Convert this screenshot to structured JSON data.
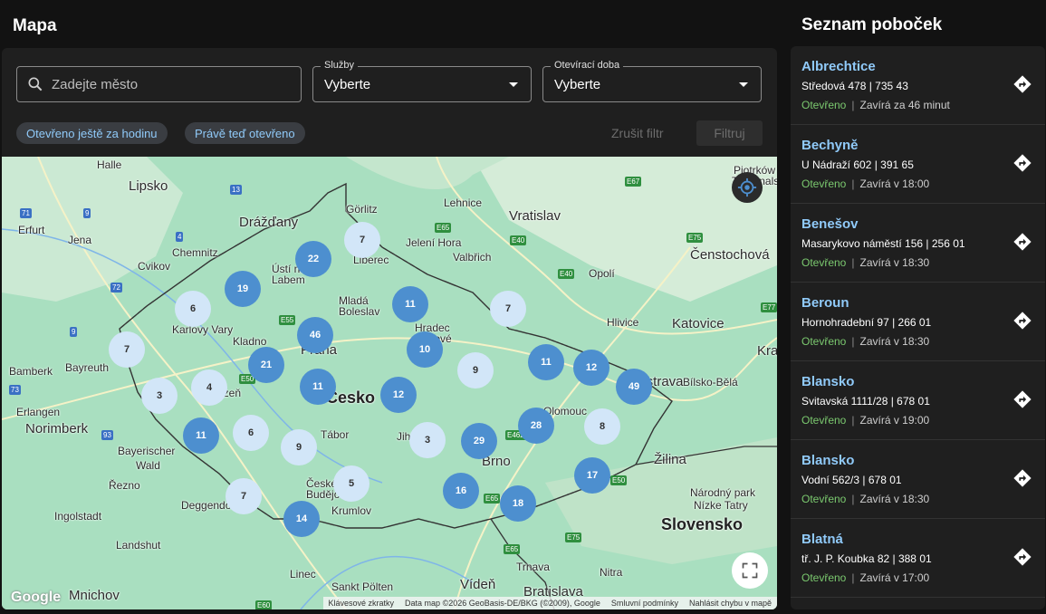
{
  "header": {
    "title": "Mapa"
  },
  "filters": {
    "search_placeholder": "Zadejte město",
    "services": {
      "label": "Služby",
      "value": "Vyberte"
    },
    "hours": {
      "label": "Otevírací doba",
      "value": "Vyberte"
    },
    "chips": [
      "Otevřeno ještě za hodinu",
      "Právě teď otevřeno"
    ],
    "clear_label": "Zrušit filtr",
    "filter_label": "Filtruj"
  },
  "map": {
    "places": {
      "halle": "Halle",
      "lipsko": "Lipsko",
      "erfurt": "Erfurt",
      "jena": "Jena",
      "drazdany": "Drážďany",
      "gorlitz": "Görlitz",
      "lehnice": "Lehnice",
      "vratislav": "Vratislav",
      "chemnitz": "Chemnitz",
      "cvikov": "Cvikov",
      "usti1": "Ústí nad",
      "usti2": "Labem",
      "liberec": "Liberec",
      "jelenigora": "Jelení Hora",
      "valbrich": "Valbřich",
      "opoli": "Opolí",
      "censtochova": "Čenstochová",
      "mlada1": "Mladá",
      "mlada2": "Boleslav",
      "hradec1": "Hradec",
      "hradec2": "Králové",
      "karlovy": "Karlovy Vary",
      "kladno": "Kladno",
      "praha": "Praha",
      "hlivice": "Hlivice",
      "katovice": "Katovice",
      "krakow": "Kra",
      "bamberk": "Bamberk",
      "bayreuth": "Bayreuth",
      "plzen": "Plzeň",
      "cesko": "Česko",
      "bielsko": "Bílsko-Bělá",
      "ostrava": "Ostrava",
      "erlangen": "Erlangen",
      "norimberk": "Norimberk",
      "olomouc": "Olomouc",
      "tabor": "Tábor",
      "jihlava": "Jihlava",
      "bayer1": "Bayerischer",
      "bayer2": "Wald",
      "brno": "Brno",
      "zilina": "Žilina",
      "rezno": "Řezno",
      "ceske1": "České",
      "ceske2": "Budějovice",
      "krumlov": "Krumlov",
      "deggendorf": "Deggendorf",
      "tatry1": "Národný park",
      "tatry2": "Nízke Tatry",
      "slovensko": "Slovensko",
      "ingolstadt": "Ingolstadt",
      "landshut": "Landshut",
      "trnava": "Trnava",
      "nitra": "Nitra",
      "linec": "Linec",
      "sanktpolten": "Sankt Pölten",
      "viden": "Vídeň",
      "bratislava": "Bratislava",
      "mnichov": "Mnichov",
      "piotrkow1": "Piotrków",
      "piotrkow2": "Trybunalski"
    },
    "roads": [
      "71",
      "9",
      "4",
      "72",
      "9",
      "73",
      "93",
      "E55",
      "E50",
      "E65",
      "E40",
      "E40",
      "E67",
      "E75",
      "E77",
      "E462",
      "E50",
      "E65",
      "E65",
      "E75",
      "E60",
      "13"
    ],
    "clusters": [
      {
        "count": "7",
        "kind": "light"
      },
      {
        "count": "22",
        "kind": "dark"
      },
      {
        "count": "19",
        "kind": "dark"
      },
      {
        "count": "6",
        "kind": "light"
      },
      {
        "count": "11",
        "kind": "dark"
      },
      {
        "count": "7",
        "kind": "light"
      },
      {
        "count": "46",
        "kind": "dark"
      },
      {
        "count": "7",
        "kind": "light"
      },
      {
        "count": "10",
        "kind": "dark"
      },
      {
        "count": "21",
        "kind": "dark"
      },
      {
        "count": "9",
        "kind": "light"
      },
      {
        "count": "11",
        "kind": "dark"
      },
      {
        "count": "12",
        "kind": "dark"
      },
      {
        "count": "4",
        "kind": "light"
      },
      {
        "count": "11",
        "kind": "dark"
      },
      {
        "count": "3",
        "kind": "light"
      },
      {
        "count": "12",
        "kind": "dark"
      },
      {
        "count": "49",
        "kind": "dark"
      },
      {
        "count": "28",
        "kind": "dark"
      },
      {
        "count": "8",
        "kind": "light"
      },
      {
        "count": "11",
        "kind": "dark"
      },
      {
        "count": "6",
        "kind": "light"
      },
      {
        "count": "9",
        "kind": "light"
      },
      {
        "count": "3",
        "kind": "light"
      },
      {
        "count": "29",
        "kind": "dark"
      },
      {
        "count": "17",
        "kind": "dark"
      },
      {
        "count": "5",
        "kind": "light"
      },
      {
        "count": "16",
        "kind": "dark"
      },
      {
        "count": "7",
        "kind": "light"
      },
      {
        "count": "18",
        "kind": "dark"
      },
      {
        "count": "14",
        "kind": "dark"
      }
    ],
    "google_logo": "Google",
    "attribution": [
      "Klávesové zkratky",
      "Data map ©2026 GeoBasis-DE/BKG (©2009), Google",
      "Smluvní podmínky",
      "Nahlásit chybu v mapě"
    ]
  },
  "list": {
    "title": "Seznam poboček",
    "branches": [
      {
        "name": "Albrechtice",
        "address": "Středová 478 | 735 43",
        "status": "Otevřeno",
        "closing": "Zavírá za 46 minut"
      },
      {
        "name": "Bechyně",
        "address": "U Nádraží 602 | 391 65",
        "status": "Otevřeno",
        "closing": "Zavírá v 18:00"
      },
      {
        "name": "Benešov",
        "address": "Masarykovo náměstí 156 | 256 01",
        "status": "Otevřeno",
        "closing": "Zavírá v 18:30"
      },
      {
        "name": "Beroun",
        "address": "Hornohradební 97 | 266 01",
        "status": "Otevřeno",
        "closing": "Zavírá v 18:30"
      },
      {
        "name": "Blansko",
        "address": "Svitavská 1111/28 | 678 01",
        "status": "Otevřeno",
        "closing": "Zavírá v 19:00"
      },
      {
        "name": "Blansko",
        "address": "Vodní 562/3 | 678 01",
        "status": "Otevřeno",
        "closing": "Zavírá v 18:30"
      },
      {
        "name": "Blatná",
        "address": "tř. J. P. Koubka 82 | 388 01",
        "status": "Otevřeno",
        "closing": "Zavírá v 17:00"
      }
    ]
  },
  "colors": {
    "accent": "#90caf9",
    "open": "#7bc96f",
    "cluster_dark": "#4d8fcf",
    "cluster_light": "#d2e6f8",
    "map_bg": "#a9dfc0"
  }
}
